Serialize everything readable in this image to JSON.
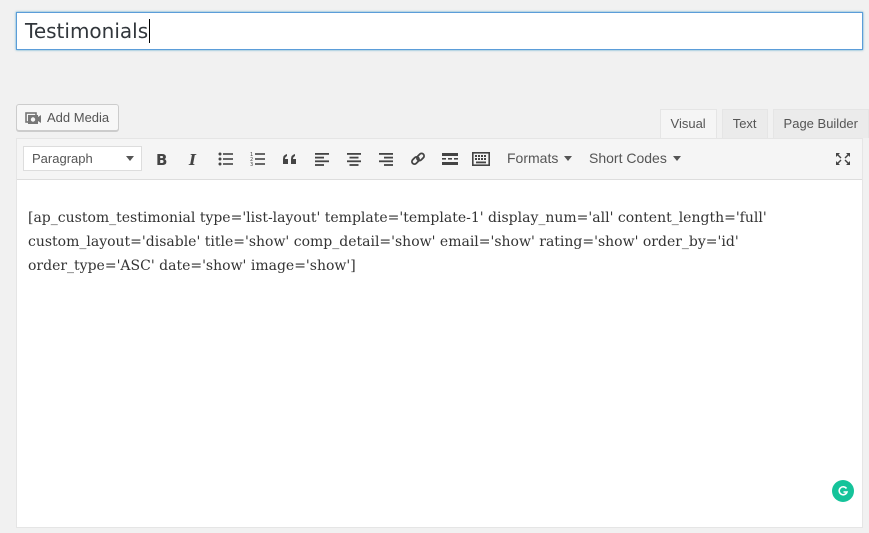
{
  "post": {
    "title_value": "Testimonials"
  },
  "media": {
    "add_media_label": "Add Media",
    "icon": "media-camera-icon"
  },
  "editor_tabs": [
    {
      "label": "Visual",
      "active": true
    },
    {
      "label": "Text",
      "active": false
    },
    {
      "label": "Page Builder",
      "active": false
    }
  ],
  "toolbar": {
    "format_select_value": "Paragraph",
    "formats_label": "Formats",
    "short_codes_label": "Short Codes",
    "buttons": [
      "bold-icon",
      "italic-icon",
      "bulleted-list-icon",
      "numbered-list-icon",
      "blockquote-icon",
      "align-left-icon",
      "align-center-icon",
      "align-right-icon",
      "link-icon",
      "read-more-icon",
      "toolbar-toggle-icon",
      "fullscreen-icon"
    ]
  },
  "content": {
    "shortcode": "[ap_custom_testimonial type='list-layout' template='template-1' display_num='all' content_length='full' custom_layout='disable' title='show' comp_detail='show' email='show' rating='show' order_by='id' order_type='ASC' date='show' image='show']"
  },
  "colors": {
    "focus_border": "#5b9dd9",
    "grammarly": "#15c39a"
  }
}
